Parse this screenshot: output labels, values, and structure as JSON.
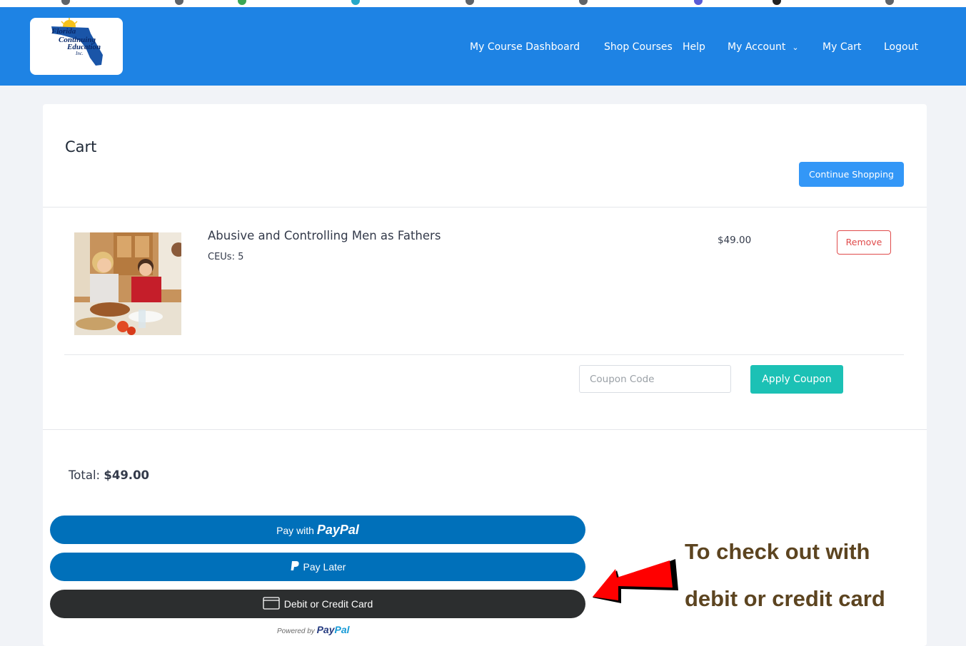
{
  "header": {
    "logo_text": "Florida Continuing Education Inc.",
    "nav": [
      {
        "label": "My Course Dashboard"
      },
      {
        "label": "Shop Courses"
      },
      {
        "label": "Help"
      },
      {
        "label": "My Account"
      },
      {
        "label": "My Cart"
      },
      {
        "label": "Logout"
      }
    ]
  },
  "cart": {
    "title": "Cart",
    "continue_label": "Continue Shopping",
    "item": {
      "title": "Abusive and Controlling Men as Fathers",
      "ceus": "CEUs: 5",
      "price": "$49.00",
      "remove_label": "Remove"
    },
    "coupon": {
      "placeholder": "Coupon Code",
      "value": "",
      "apply_label": "Apply Coupon"
    },
    "total": {
      "label": "Total:",
      "value": "$49.00"
    }
  },
  "payment": {
    "paypal": {
      "prefix": "Pay with",
      "brand_pay": "Pay",
      "brand_pal": "Pal"
    },
    "paylater": {
      "label": "Pay Later"
    },
    "card": {
      "label": "Debit or Credit Card"
    },
    "powered": {
      "prefix": "Powered by",
      "brand_pay": "Pay",
      "brand_pal": "Pal"
    }
  },
  "annotation": {
    "line1": "To check out with",
    "line2": "debit or credit card",
    "color": "#5c4420"
  },
  "colors": {
    "header_bg": "#1e83e4",
    "continue_btn": "#3397f7",
    "apply_btn": "#1cc1b5",
    "remove_border": "#e04b4b",
    "paypal_blue": "#0070ba",
    "card_btn": "#2c2e2f",
    "arrow": "#ff0000"
  }
}
